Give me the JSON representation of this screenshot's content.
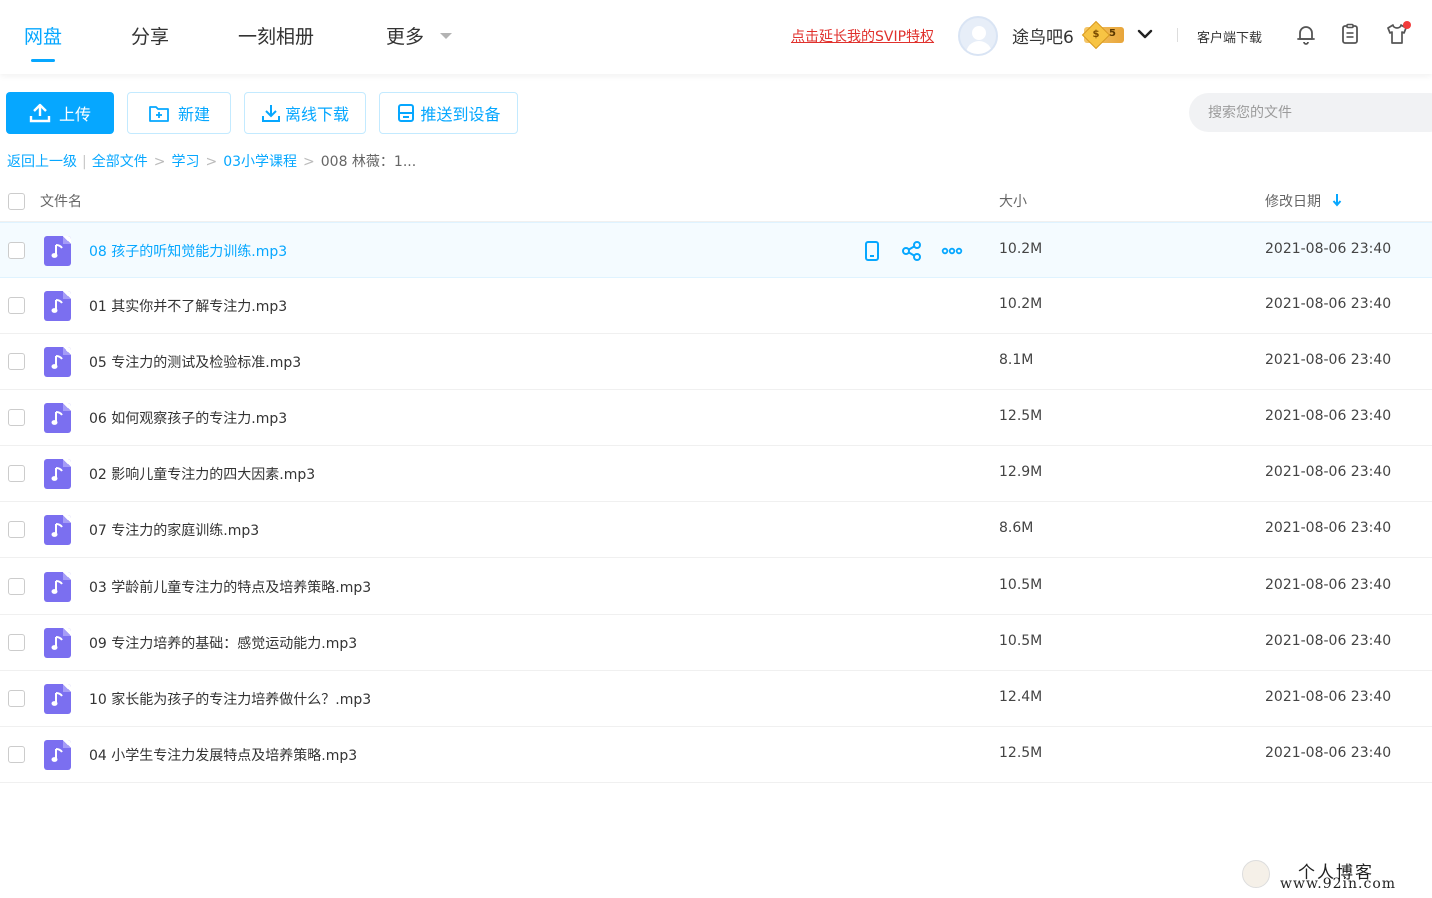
{
  "nav": {
    "tabs": [
      "网盘",
      "分享",
      "一刻相册",
      "更多"
    ],
    "active": "网盘"
  },
  "header": {
    "svip_link": "点击延长我的SVIP特权",
    "username": "途鸟吧6",
    "vip_coin": "$",
    "vip_level": "5",
    "client_download": "客户端下载"
  },
  "toolbar": {
    "upload": "上传",
    "new": "新建",
    "offline_download": "离线下载",
    "push_device": "推送到设备",
    "search_placeholder": "搜索您的文件"
  },
  "breadcrumb": {
    "back": "返回上一级",
    "all_files": "全部文件",
    "path": [
      "学习",
      "03小学课程"
    ],
    "current": "008 林薇：1..."
  },
  "table": {
    "headers": {
      "name": "文件名",
      "size": "大小",
      "date": "修改日期"
    },
    "rows": [
      {
        "name": "08 孩子的听知觉能力训练.mp3",
        "size": "10.2M",
        "date": "2021-08-06 23:40"
      },
      {
        "name": "01 其实你并不了解专注力.mp3",
        "size": "10.2M",
        "date": "2021-08-06 23:40"
      },
      {
        "name": "05 专注力的测试及检验标准.mp3",
        "size": "8.1M",
        "date": "2021-08-06 23:40"
      },
      {
        "name": "06 如何观察孩子的专注力.mp3",
        "size": "12.5M",
        "date": "2021-08-06 23:40"
      },
      {
        "name": "02 影响儿童专注力的四大因素.mp3",
        "size": "12.9M",
        "date": "2021-08-06 23:40"
      },
      {
        "name": "07 专注力的家庭训练.mp3",
        "size": "8.6M",
        "date": "2021-08-06 23:40"
      },
      {
        "name": "03 学龄前儿童专注力的特点及培养策略.mp3",
        "size": "10.5M",
        "date": "2021-08-06 23:40"
      },
      {
        "name": "09 专注力培养的基础：感觉运动能力.mp3",
        "size": "10.5M",
        "date": "2021-08-06 23:40"
      },
      {
        "name": "10 家长能为孩子的专注力培养做什么？.mp3",
        "size": "12.4M",
        "date": "2021-08-06 23:40"
      },
      {
        "name": "04 小学生专注力发展特点及培养策略.mp3",
        "size": "12.5M",
        "date": "2021-08-06 23:40"
      }
    ]
  },
  "watermark": {
    "line1": "个人博客",
    "line2": "www.92in.com"
  },
  "colors": {
    "accent": "#06a7ff",
    "svip": "#e0312d",
    "audio_icon": "#7b6ff0"
  }
}
